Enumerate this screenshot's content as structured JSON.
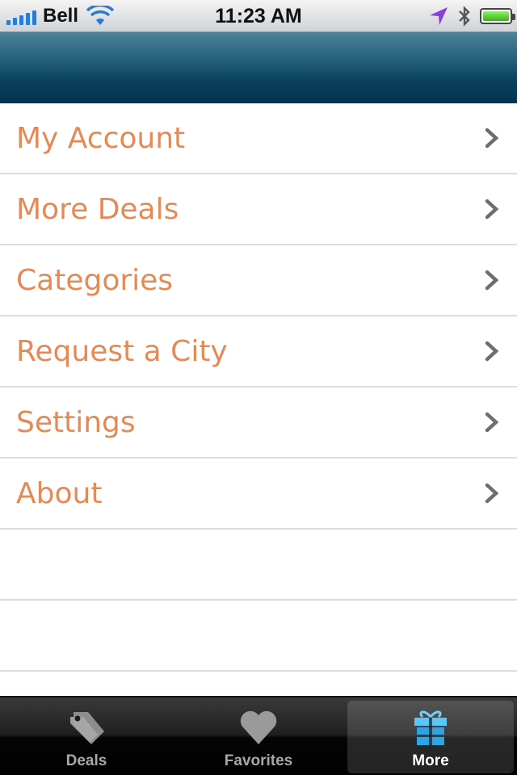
{
  "status_bar": {
    "carrier": "Bell",
    "time": "11:23 AM",
    "battery_level": 1.0
  },
  "menu": {
    "items": [
      {
        "label": "My Account",
        "icon": "chevron-right-icon"
      },
      {
        "label": "More Deals",
        "icon": "chevron-right-icon"
      },
      {
        "label": "Categories",
        "icon": "chevron-right-icon"
      },
      {
        "label": "Request a City",
        "icon": "chevron-right-icon"
      },
      {
        "label": "Settings",
        "icon": "chevron-right-icon"
      },
      {
        "label": "About",
        "icon": "chevron-right-icon"
      }
    ]
  },
  "tab_bar": {
    "tabs": [
      {
        "label": "Deals",
        "icon": "tag-icon",
        "active": false
      },
      {
        "label": "Favorites",
        "icon": "heart-icon",
        "active": false
      },
      {
        "label": "More",
        "icon": "gift-icon",
        "active": true
      }
    ]
  },
  "colors": {
    "menu_text": "#e58a55",
    "nav_bar": "#0a3f5c",
    "active_tab_icon": "#3ea9e8"
  }
}
